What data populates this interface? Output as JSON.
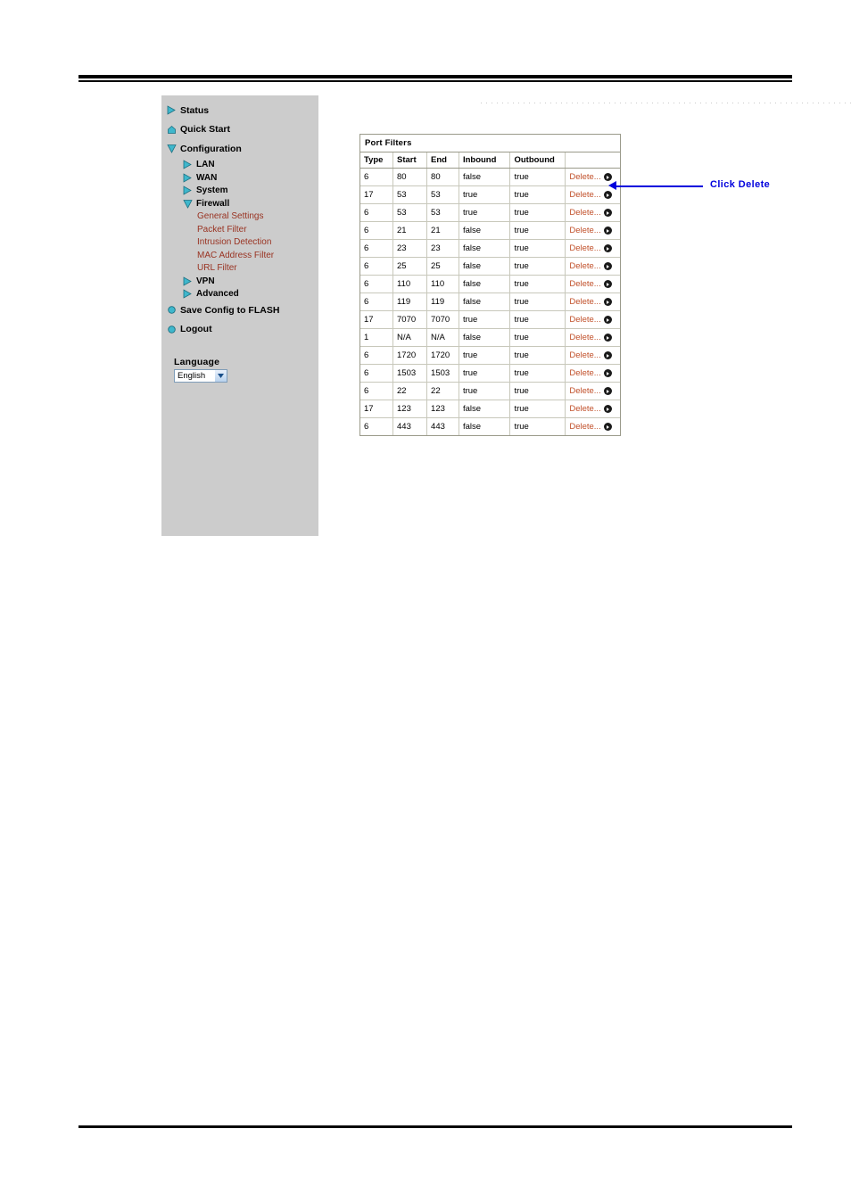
{
  "page": {
    "title": "Port Filters"
  },
  "sidebar": {
    "items": [
      {
        "label": "Status",
        "icon": "triangle-right-icon",
        "level": 0
      },
      {
        "label": "Quick Start",
        "icon": "home-icon",
        "level": 0
      },
      {
        "label": "Configuration",
        "icon": "triangle-down-icon",
        "level": 0
      },
      {
        "label": "LAN",
        "icon": "triangle-right-icon",
        "level": 1
      },
      {
        "label": "WAN",
        "icon": "triangle-right-icon",
        "level": 1
      },
      {
        "label": "System",
        "icon": "triangle-right-icon",
        "level": 1
      },
      {
        "label": "Firewall",
        "icon": "triangle-down-icon",
        "level": 1
      },
      {
        "label": "General Settings",
        "icon": "none",
        "level": 2
      },
      {
        "label": "Packet Filter",
        "icon": "none",
        "level": 2
      },
      {
        "label": "Intrusion Detection",
        "icon": "none",
        "level": 2
      },
      {
        "label": "MAC Address Filter",
        "icon": "none",
        "level": 2
      },
      {
        "label": "URL Filter",
        "icon": "none",
        "level": 2
      },
      {
        "label": "VPN",
        "icon": "triangle-right-icon",
        "level": 1
      },
      {
        "label": "Advanced",
        "icon": "triangle-right-icon",
        "level": 1
      },
      {
        "label": "Save Config to FLASH",
        "icon": "dot-icon",
        "level": 0
      },
      {
        "label": "Logout",
        "icon": "dot-icon",
        "level": 0
      }
    ],
    "language": {
      "label": "Language",
      "selected": "English",
      "options": [
        "English"
      ]
    }
  },
  "table": {
    "caption": "Port Filters",
    "columns": [
      "Type",
      "Start",
      "End",
      "Inbound",
      "Outbound",
      ""
    ],
    "action_label": "Delete...",
    "rows": [
      {
        "type": "6",
        "start": "80",
        "end": "80",
        "inbound": "false",
        "outbound": "true"
      },
      {
        "type": "17",
        "start": "53",
        "end": "53",
        "inbound": "true",
        "outbound": "true"
      },
      {
        "type": "6",
        "start": "53",
        "end": "53",
        "inbound": "true",
        "outbound": "true"
      },
      {
        "type": "6",
        "start": "21",
        "end": "21",
        "inbound": "false",
        "outbound": "true"
      },
      {
        "type": "6",
        "start": "23",
        "end": "23",
        "inbound": "false",
        "outbound": "true"
      },
      {
        "type": "6",
        "start": "25",
        "end": "25",
        "inbound": "false",
        "outbound": "true"
      },
      {
        "type": "6",
        "start": "110",
        "end": "110",
        "inbound": "false",
        "outbound": "true"
      },
      {
        "type": "6",
        "start": "119",
        "end": "119",
        "inbound": "false",
        "outbound": "true"
      },
      {
        "type": "17",
        "start": "7070",
        "end": "7070",
        "inbound": "true",
        "outbound": "true"
      },
      {
        "type": "1",
        "start": "N/A",
        "end": "N/A",
        "inbound": "false",
        "outbound": "true"
      },
      {
        "type": "6",
        "start": "1720",
        "end": "1720",
        "inbound": "true",
        "outbound": "true"
      },
      {
        "type": "6",
        "start": "1503",
        "end": "1503",
        "inbound": "true",
        "outbound": "true"
      },
      {
        "type": "6",
        "start": "22",
        "end": "22",
        "inbound": "true",
        "outbound": "true"
      },
      {
        "type": "17",
        "start": "123",
        "end": "123",
        "inbound": "false",
        "outbound": "true"
      },
      {
        "type": "6",
        "start": "443",
        "end": "443",
        "inbound": "false",
        "outbound": "true"
      }
    ]
  },
  "annotation": {
    "text": "Click Delete",
    "color": "#0000dd"
  },
  "colors": {
    "sidebar_bg": "#cccccc",
    "link_red": "#993322",
    "delete_orange": "#c1502a",
    "icon_teal": "#3fb7cc",
    "annotation_blue": "#0000dd"
  }
}
